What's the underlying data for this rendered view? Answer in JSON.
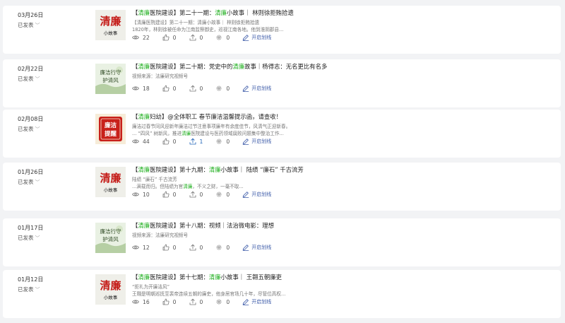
{
  "articles": [
    {
      "date": "03月26日",
      "status": "已发表",
      "thumb": "qinglian-story",
      "title_parts": [
        [
          "【",
          ""
        ],
        [
          "清廉",
          "hl"
        ],
        [
          "医院建设】第二十一期：",
          ""
        ],
        [
          "清廉",
          "hl"
        ],
        [
          "小故事｜ 林则徐拒贿拾遗",
          ""
        ]
      ],
      "desc_lines": [
        [
          [
            "【清廉医院建设】第二十一期：清廉小故事｜ 林则徐拒贿拾遗",
            ""
          ]
        ],
        [
          [
            "1820年，林则徐被任命为江南监察御史，巡视江南各地。他到淮阴郡县...",
            ""
          ]
        ]
      ],
      "views": "22",
      "likes": "0",
      "shares": "0",
      "favs": "0",
      "share_blue": false,
      "open_label": "开启划线"
    },
    {
      "date": "02月22日",
      "status": "已发表",
      "thumb": "qinglian-calligraphy",
      "title_parts": [
        [
          "【",
          ""
        ],
        [
          "清廉",
          "hl"
        ],
        [
          "医院建设】第二十期：党史中的",
          ""
        ],
        [
          "清廉",
          "hl"
        ],
        [
          "故事｜杨得志：无名更比有名多",
          ""
        ]
      ],
      "desc_lines": [
        [
          [
            "视频来源：法廉研究视频号",
            ""
          ]
        ]
      ],
      "views": "18",
      "likes": "0",
      "shares": "0",
      "favs": "0",
      "share_blue": false,
      "open_label": "开启划线"
    },
    {
      "date": "02月08日",
      "status": "已发表",
      "thumb": "reminder-stamp",
      "title_parts": [
        [
          "【",
          ""
        ],
        [
          "清廉",
          "hl"
        ],
        [
          "妇幼】@全体职工 春节廉洁温馨提示函，请查收！",
          ""
        ]
      ],
      "desc_lines": [
        [
          [
            "廉洁过春节同风迎新年廉洁过节注意事项廉年有余度佳节，风清气正迎新春。",
            ""
          ]
        ],
        [
          [
            "... “四风” 树新风，推进",
            ""
          ],
          [
            "清廉",
            "hl"
          ],
          [
            "医院建设与医药领域腐败问题集中整治工作...",
            ""
          ]
        ]
      ],
      "views": "44",
      "likes": "0",
      "shares": "1",
      "favs": "0",
      "share_blue": true,
      "open_label": "开启划线"
    },
    {
      "date": "01月26日",
      "status": "已发表",
      "thumb": "qinglian-story",
      "title_parts": [
        [
          "【",
          ""
        ],
        [
          "清廉",
          "hl"
        ],
        [
          "医院建设】第十九期：",
          ""
        ],
        [
          "清廉",
          "hl"
        ],
        [
          "小故事｜ 陆绩 “廉石” 千古流芳",
          ""
        ]
      ],
      "desc_lines": [
        [
          [
            "陆绩 “廉石” 千古流芳",
            ""
          ]
        ],
        [
          [
            "...满载而归。但陆绩为官",
            ""
          ],
          [
            "清廉",
            "hl"
          ],
          [
            "，不义之财，一毫不取...",
            ""
          ]
        ]
      ],
      "views": "10",
      "likes": "0",
      "shares": "0",
      "favs": "0",
      "share_blue": false,
      "open_label": "开启划线"
    },
    {
      "date": "01月17日",
      "status": "已发表",
      "thumb": "qinglian-calligraphy",
      "title_parts": [
        [
          "【",
          ""
        ],
        [
          "清廉",
          "hl"
        ],
        [
          "医院建设】第十八期：视频｜法治微电影：理想",
          ""
        ]
      ],
      "desc_lines": [
        [
          [
            "视频来源：法廉研究视频号",
            ""
          ]
        ]
      ],
      "views": "12",
      "likes": "0",
      "shares": "0",
      "favs": "0",
      "share_blue": false,
      "open_label": "开启划线"
    },
    {
      "date": "01月12日",
      "status": "已发表",
      "thumb": "qinglian-story",
      "title_parts": [
        [
          "【",
          ""
        ],
        [
          "清廉",
          "hl"
        ],
        [
          "医院建设】第十七期：",
          ""
        ],
        [
          "清廉",
          "hl"
        ],
        [
          "小故事｜ 王翱五朝廉吏",
          ""
        ]
      ],
      "desc_lines": [
        [
          [
            "“拒礼为开廉洁风”",
            ""
          ]
        ],
        [
          [
            "王翱是明朝巡抚至裴帝连续五朝的廉吏，他身居官场几十年，尽管位高权...",
            ""
          ]
        ]
      ],
      "views": "16",
      "likes": "0",
      "shares": "0",
      "favs": "0",
      "share_blue": false,
      "open_label": "开启划线"
    }
  ],
  "thumb_text": {
    "story_big": "清廉",
    "story_small": "小故事",
    "calligraphy": "廉洁行守护清风",
    "reminder": "廉洁提醒"
  },
  "colors": {
    "highlight": "#1aad19",
    "link": "#3d5ba9",
    "share_active": "#1f63b8"
  }
}
